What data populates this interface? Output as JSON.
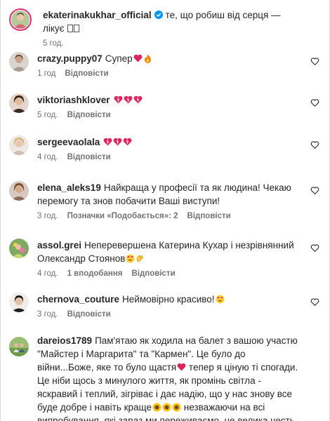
{
  "caption": {
    "username": "ekaterinakukhar_official",
    "text": "те, що робиш від серця — лікує",
    "time": "5 год."
  },
  "comments": [
    {
      "username": "crazy.puppy07",
      "text": "Супер",
      "time": "1 год",
      "reply": "Відповісти"
    },
    {
      "username": "viktoriashklover",
      "text": "",
      "time": "5 год.",
      "reply": "Відповісти"
    },
    {
      "username": "sergeevaolala",
      "text": "",
      "time": "4 год.",
      "reply": "Відповісти"
    },
    {
      "username": "elena_aleks19",
      "text": "Найкраща у професії та як людина! Чекаю перемогу та знов побачити Ваші виступи!",
      "time": "3 год.",
      "likes": "Позначки «Подобається»: 2",
      "reply": "Відповісти"
    },
    {
      "username": "assol.grei",
      "text": "Неперевершена Катерина Кухар і незрівнянний Олександр Стоянов",
      "time": "4 год.",
      "likes": "1 вподобання",
      "reply": "Відповісти"
    },
    {
      "username": "chernova_couture",
      "text": "Неймовірно красиво!",
      "time": "3 год.",
      "reply": "Відповісти"
    },
    {
      "username": "dareios1789",
      "text_a": "Пам'ятаю як ходила на балет з вашою участю \"Майстер і Маргарита\" та \"Кармен\". Це було до війни...Боже, яке то було щастя",
      "text_b": " тепер я ціную ті спогади. Це ніби щось з минулого життя, як промінь світла - яскравий і теплий, зігріває і дає надію, що у нас знову все буде добре і навіть краще",
      "text_c": " незважаючи на всі випробування, які зараз ми переживаємо, це велика честь"
    }
  ],
  "colors": {
    "text": "#262626",
    "meta": "#737373",
    "verified": "#0095f6",
    "heart_emoji": "#e0245e"
  },
  "icons": [
    "verified-badge-icon",
    "heart-outline-icon",
    "heart-emoji-icon",
    "fire-emoji-icon",
    "heart-eyes-emoji-icon",
    "clap-emoji-icon",
    "sunflower-emoji-icon"
  ]
}
